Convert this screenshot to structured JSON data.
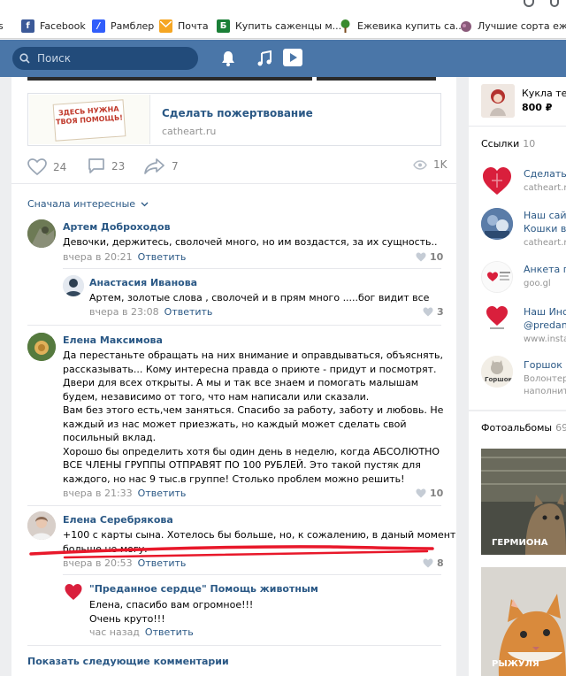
{
  "bookmarks": [
    {
      "label": "s",
      "icon": "windows-icon"
    },
    {
      "label": "Facebook",
      "icon": "facebook-icon"
    },
    {
      "label": "Рамблер",
      "icon": "rambler-icon"
    },
    {
      "label": "Почта",
      "icon": "mail-icon"
    },
    {
      "label": "Купить саженцы м...",
      "icon": "b-icon"
    },
    {
      "label": "Ежевика купить са...",
      "icon": "tree-icon"
    },
    {
      "label": "Лучшие сорта ежев...",
      "icon": "fruit-icon"
    }
  ],
  "header": {
    "search_placeholder": "Поиск"
  },
  "post": {
    "donate_title": "Сделать пожертвование",
    "donate_domain": "catheart.ru",
    "donate_sign": "ЗДЕСЬ НУЖНА ТВОЯ ПОМОЩЬ!",
    "likes": "24",
    "comments": "23",
    "shares": "7",
    "views": "1K"
  },
  "sort_label": "Сначала интересные",
  "comments": [
    {
      "author": "Артем Доброходов",
      "lines": [
        "Девочки, держитесь, сволочей много, но им воздастся, за их сущность.."
      ],
      "time": "вчера в 20:21",
      "reply": "Ответить",
      "likes": "10",
      "replies": [
        {
          "author": "Анастасия Иванова",
          "lines": [
            "Артем, золотые слова , сволочей и в прям много .....бог видит все"
          ],
          "time": "вчера в 23:08",
          "reply": "Ответить",
          "likes": "3"
        }
      ]
    },
    {
      "author": "Елена Максимова",
      "lines": [
        "Да перестаньте обращать на них внимание и оправдываться, объяснять,",
        "рассказывать... Кому интересна правда о приюте - придут и посмотрят.",
        "Двери для всех открыты. А мы и так все знаем и помогать малышам",
        "будем, независимо от того, что нам написали или сказали.",
        "Вам без этого есть,чем заняться. Спасибо за работу, заботу и любовь. Не",
        "каждый из нас может приезжать, но каждый может сделать свой",
        "посильный вклад.",
        "Хорошо бы определить хотя бы один день в неделю, когда АБСОЛЮТНО",
        "ВСЕ ЧЛЕНЫ ГРУППЫ ОТПРАВЯТ ПО 100 РУБЛЕЙ. Это такой пустяк для",
        "каждого, но нас 9 тыс.в группе! Столько проблем можно решить!"
      ],
      "time": "вчера в 21:33",
      "reply": "Ответить",
      "likes": "10"
    },
    {
      "author": "Елена Серебрякова",
      "lines": [
        "+100 с карты сына. Хотелось бы больше, но, к сожалению, в даный момент",
        "больше не могу."
      ],
      "time": "вчера в 20:53",
      "reply": "Ответить",
      "likes": "8",
      "replies": [
        {
          "author": "\"Преданное сердце\" Помощь животным",
          "lines": [
            "Елена, спасибо вам огромное!!!",
            "Очень круто!!!"
          ],
          "time": "час назад",
          "reply": "Ответить"
        }
      ]
    }
  ],
  "show_more": "Показать следующие комментарии",
  "sidebar": {
    "product_title": "Кукла тек",
    "product_price": "800 ₽",
    "links_title": "Ссылки",
    "links_count": "10",
    "links": [
      {
        "title": "Сделать",
        "url": "catheart.r"
      },
      {
        "title": "Наш сайт",
        "title2": "Кошки в",
        "url": "catheart.r"
      },
      {
        "title": "Анкета п",
        "url": "goo.gl"
      },
      {
        "title": "Наш Инс",
        "title2": "@predan",
        "url": "www.insta"
      },
      {
        "title": "Горшок",
        "title2": "Волонтер",
        "url": "наполнит"
      }
    ],
    "gorshok_badge": "Горшок",
    "albums_title": "Фотоальбомы",
    "albums_count": "69",
    "albums": [
      "ГЕРМИОНА",
      "РЫЖУЛЯ"
    ]
  },
  "colors": {
    "vk_blue": "#4a76a8",
    "link": "#2a5885",
    "annotation_red": "#e8182a"
  }
}
